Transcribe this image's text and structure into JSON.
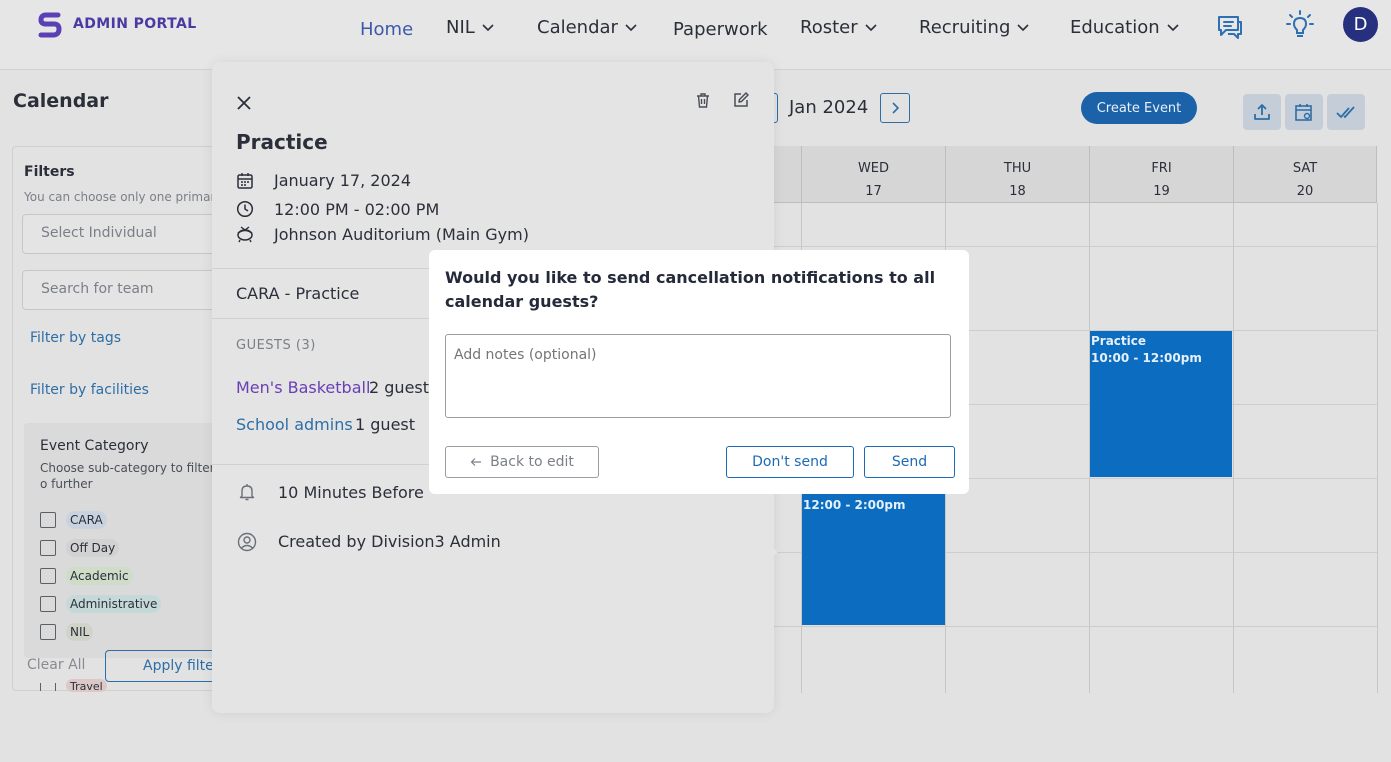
{
  "header": {
    "logo_text": "ADMIN PORTAL",
    "nav": [
      {
        "label": "Home",
        "active": true
      },
      {
        "label": "NIL",
        "has_dropdown": true
      },
      {
        "label": "Calendar",
        "has_dropdown": true
      },
      {
        "label": "Paperwork"
      },
      {
        "label": "Roster",
        "has_dropdown": true
      },
      {
        "label": "Recruiting",
        "has_dropdown": true
      },
      {
        "label": "Education",
        "has_dropdown": true
      }
    ],
    "icons": [
      "chat-icon",
      "lightbulb-icon"
    ],
    "avatar_initial": "D"
  },
  "page": {
    "title": "Calendar"
  },
  "filters": {
    "title": "Filters",
    "hint": "You can choose only one primary f",
    "individual_placeholder": "Select Individual",
    "team_placeholder": "Search for team",
    "filter_by_tags": "Filter by tags",
    "filter_by_facilities": "Filter by facilities",
    "event_category": {
      "title": "Event Category",
      "subtitle": "Choose sub-category to filter o further",
      "items": [
        {
          "label": "CARA",
          "color": "#c9d3df"
        },
        {
          "label": "Off Day",
          "color": "#d2d2d2"
        },
        {
          "label": "Academic",
          "color": "#cfdcc8"
        },
        {
          "label": "Administrative",
          "color": "#c6d9d9"
        },
        {
          "label": "NIL",
          "color": "#cfd3c8"
        },
        {
          "label": "Travel",
          "color": "#ddc8c8"
        }
      ]
    },
    "clear_all": "Clear All",
    "apply": "Apply filters"
  },
  "calendar": {
    "month": "Jan 2024",
    "create_event": "Create Event",
    "days": [
      {
        "dow": "WED",
        "date": "17"
      },
      {
        "dow": "THU",
        "date": "18"
      },
      {
        "dow": "FRI",
        "date": "19"
      },
      {
        "dow": "SAT",
        "date": "20"
      }
    ],
    "events": [
      {
        "title": "Practice",
        "time": "10:00 - 12:00pm"
      },
      {
        "title": "",
        "time": "12:00 - 2:00pm"
      }
    ],
    "accent": "#0b6cc0"
  },
  "event_detail": {
    "title": "Practice",
    "date": "January 17, 2024",
    "time": "12:00 PM - 02:00 PM",
    "location": "Johnson Auditorium (Main Gym)",
    "team": "CARA - Practice",
    "guests_header": "GUESTS (3)",
    "guests": [
      {
        "name": "Men's Basketball",
        "count": "2 guests",
        "color": "#6a3fb5"
      },
      {
        "name": "School admins",
        "count": "1 guest",
        "color": "#2d6ea6"
      }
    ],
    "reminder": "10 Minutes Before",
    "created_by": "Created by Division3 Admin"
  },
  "modal": {
    "question": "Would you like to send cancellation notifications to all calendar guests?",
    "notes_placeholder": "Add notes (optional)",
    "back": "Back to edit",
    "dont_send": "Don't send",
    "send": "Send"
  }
}
